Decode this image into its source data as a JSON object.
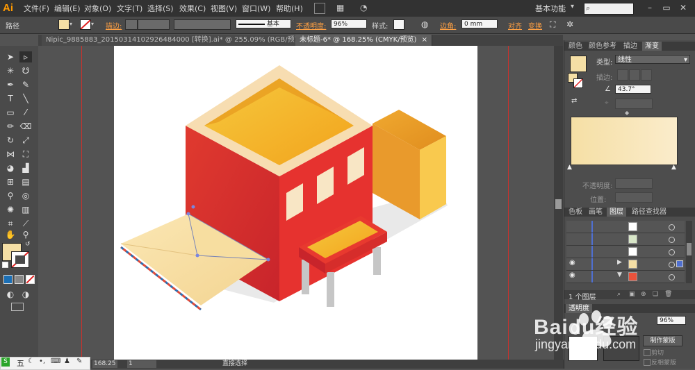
{
  "app": {
    "logo": "Ai",
    "workspace": "基本功能"
  },
  "menu": [
    "文件(F)",
    "编辑(E)",
    "对象(O)",
    "文字(T)",
    "选择(S)",
    "效果(C)",
    "视图(V)",
    "窗口(W)",
    "帮助(H)"
  ],
  "control": {
    "object_type": "路径",
    "stroke_label": "描边:",
    "brush_label": "基本",
    "opacity_label": "不透明度:",
    "opacity_value": "96%",
    "style_label": "样式:",
    "corner_label": "边角:",
    "corner_value": "0 mm",
    "align_label": "对齐",
    "transform_label": "变换"
  },
  "tabs": [
    {
      "label": "Nipic_9885883_20150314102926484000 [转换].ai* @ 255.09% (RGB/预览)",
      "close": "×",
      "active": false
    },
    {
      "label": "未标题-6* @ 168.25% (CMYK/预览)",
      "close": "×",
      "active": true
    }
  ],
  "gradient_panel": {
    "tabs": [
      "颜色",
      "颜色参考",
      "描边",
      "渐变"
    ],
    "type_label": "类型:",
    "type_value": "线性",
    "stroke_label": "描边:",
    "angle_value": "43.7°",
    "opacity_label": "不透明度:",
    "position_label": "位置:"
  },
  "layers_panel": {
    "tabs": [
      "色板",
      "画笔",
      "图层",
      "路径查找器"
    ],
    "footer": "1 个图层"
  },
  "bottom_panel": {
    "tab": "透明度",
    "value": "96%",
    "make_mask": "制作蒙版",
    "clip": "剪切",
    "invert": "反相蒙版"
  },
  "status": {
    "zoom": "168.25",
    "page": "1",
    "tool": "直接选择"
  },
  "ime": {
    "label": "五"
  },
  "watermark": {
    "brand": "Baidu经验",
    "url": "jingyan.baidu.com"
  },
  "colors": {
    "fill_swatch": "#f5dfa5",
    "building_red": "#e0322f",
    "roof_yellow": "#f7b928",
    "accent_orange": "#ffa043"
  }
}
